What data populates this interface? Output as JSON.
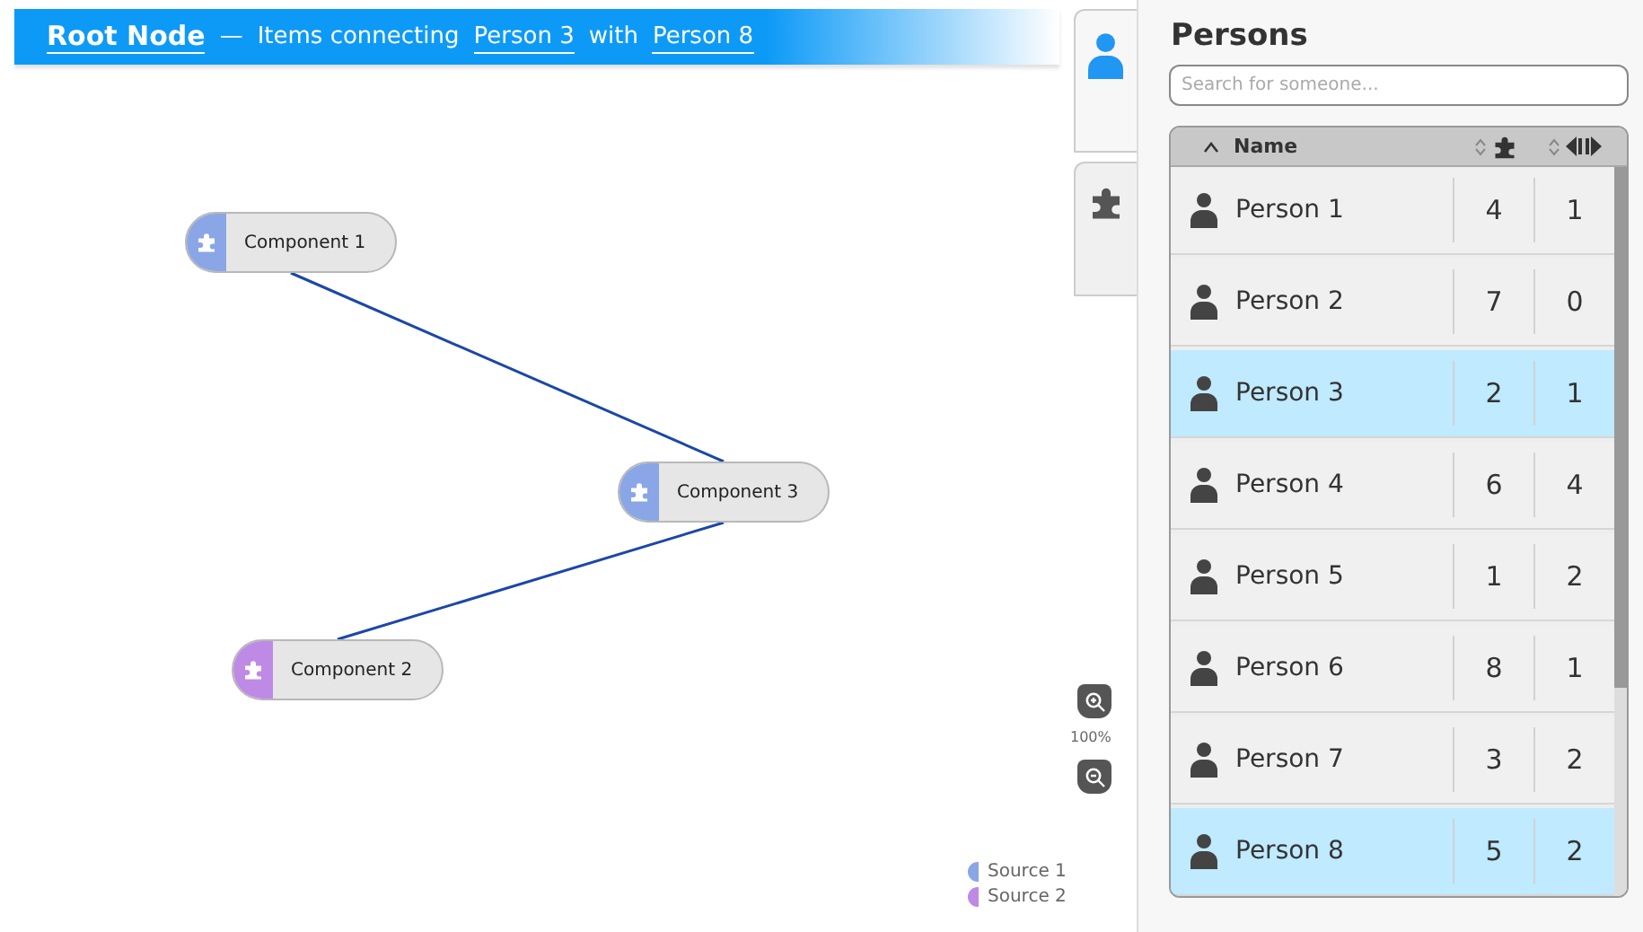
{
  "header": {
    "root": "Root Node",
    "separator": "—",
    "text_1": "Items connecting",
    "link_1": "Person 3",
    "text_2": "with",
    "link_2": "Person 8"
  },
  "canvas": {
    "nodes": [
      {
        "label": "Component 1",
        "color": "#8aa6e6"
      },
      {
        "label": "Component 3",
        "color": "#8aa6e6"
      },
      {
        "label": "Component 2",
        "color": "#be8ae6"
      }
    ],
    "zoom": "100%",
    "legend": [
      {
        "label": "Source 1",
        "color": "#8aa6e6"
      },
      {
        "label": "Source 2",
        "color": "#be8ae6"
      }
    ]
  },
  "side_tabs": [
    {
      "kind": "person",
      "selected": true
    },
    {
      "kind": "component",
      "selected": false
    }
  ],
  "panel": {
    "title": "Persons",
    "search": {
      "placeholder": "Search for someone..."
    },
    "columns": [
      {
        "kind": "name",
        "label": "Name",
        "sorted": true
      },
      {
        "kind": "components",
        "sorted": false
      },
      {
        "kind": "connections",
        "sorted": false
      }
    ],
    "rows": [
      {
        "name": "Person 1",
        "components": "4",
        "connections": "1",
        "selected": false
      },
      {
        "name": "Person 2",
        "components": "7",
        "connections": "0",
        "selected": false
      },
      {
        "name": "Person 3",
        "components": "2",
        "connections": "1",
        "selected": true
      },
      {
        "name": "Person 4",
        "components": "6",
        "connections": "4",
        "selected": false
      },
      {
        "name": "Person 5",
        "components": "1",
        "connections": "2",
        "selected": false
      },
      {
        "name": "Person 6",
        "components": "8",
        "connections": "1",
        "selected": false
      },
      {
        "name": "Person 7",
        "components": "3",
        "connections": "2",
        "selected": false
      },
      {
        "name": "Person 8",
        "components": "5",
        "connections": "2",
        "selected": true
      }
    ]
  }
}
